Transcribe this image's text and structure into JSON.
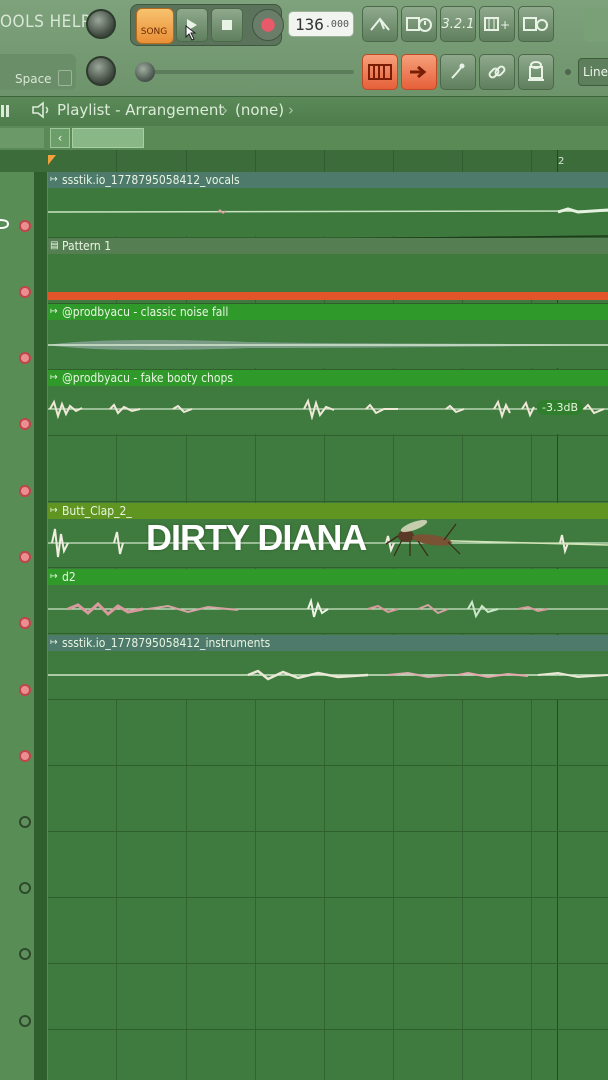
{
  "toolbar": {
    "menu_label": "OOLS HELP",
    "space_label": "Space",
    "song_label": "SONG",
    "tempo_value": "136",
    "tempo_fraction": ".000",
    "metronome_text": "3.2.1",
    "line_label": "Line"
  },
  "playlist": {
    "title": "Playlist - Arrangement",
    "separator": "›",
    "pattern_selector": "(none)",
    "ruler_bar": "2"
  },
  "tracks": [
    {
      "name": "ssstik.io_1778795058412_vocals",
      "type": "audio",
      "color": "#4d7a6a"
    },
    {
      "name": "Pattern 1",
      "type": "pattern",
      "color": "#4c7a49"
    },
    {
      "name": "@prodbyacu - classic noise fall",
      "type": "audio",
      "color": "#2f9a2a"
    },
    {
      "name": "@prodbyacu - fake booty chops",
      "type": "audio",
      "color": "#2f9a2a",
      "volume_badge": "-3.3dB"
    },
    {
      "name": "Butt_Clap_2_",
      "type": "audio",
      "color": "#5f9520"
    },
    {
      "name": "d2",
      "type": "audio",
      "color": "#2f9a2a"
    },
    {
      "name": "ssstik.io_1778795058412_instruments",
      "type": "audio",
      "color": "#4d7a6a"
    }
  ],
  "overlay_caption": "DIRTY DIANA",
  "colors": {
    "accent_orange": "#e6603a",
    "pattern_strip": "#e2552b",
    "grid_green": "#3f7a3f",
    "mute_red": "#c0444a"
  }
}
